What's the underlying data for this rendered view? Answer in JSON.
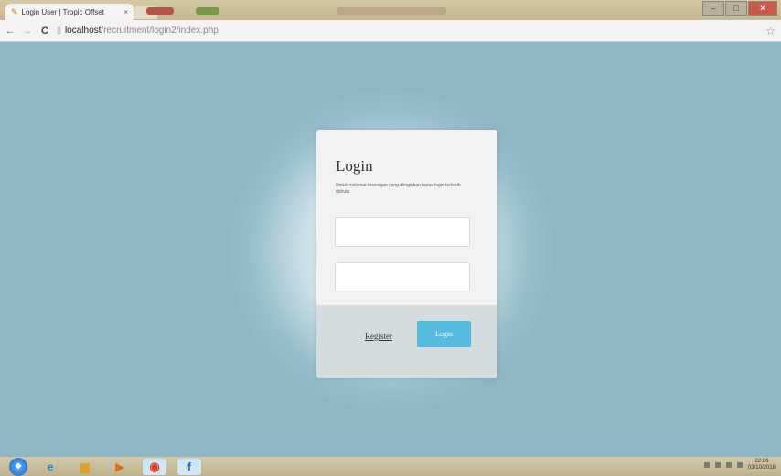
{
  "browser": {
    "tab_title": "Login User | Tropic Offset",
    "tab_close": "×",
    "url_host": "localhost",
    "url_path": "/recruitment/login2/index.php",
    "nav": {
      "back": "←",
      "forward": "→",
      "reload": "C"
    },
    "window_controls": {
      "minimize": "–",
      "maximize": "□",
      "close": "✕"
    }
  },
  "login": {
    "title": "Login",
    "description": "Untuk melamar lowongan yang diinginkan harus login terlebih dahulu",
    "username": {
      "value": "",
      "placeholder": ""
    },
    "password": {
      "value": "",
      "placeholder": ""
    },
    "register_label": "Register",
    "login_label": "Login"
  },
  "taskbar": {
    "apps": [
      "start-orb-icon",
      "internet-explorer-icon",
      "folder-icon",
      "media-player-icon",
      "chrome-icon",
      "facebook-icon"
    ],
    "clock_time": "22:08",
    "clock_date": "03/10/2016"
  },
  "colors": {
    "page_background": "#8fb6c4",
    "card_background": "#f2f2f2",
    "card_footer": "#d4dcdd",
    "login_button": "#56bcdf"
  }
}
